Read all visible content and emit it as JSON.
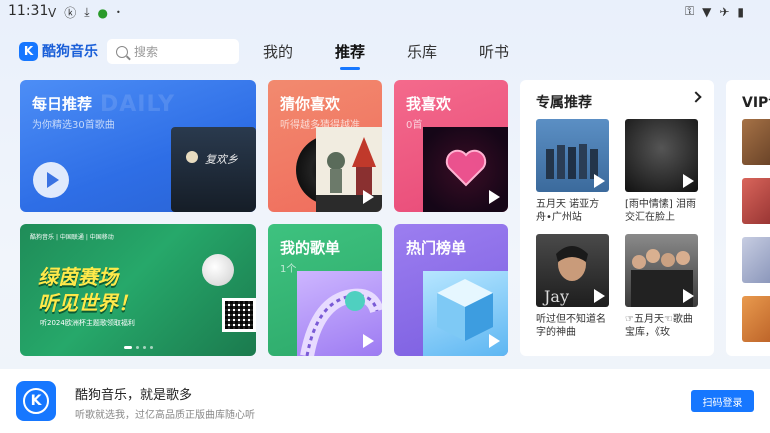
{
  "status_bar": {
    "time": "11:31",
    "left_icons": [
      "v-icon",
      "k-icon",
      "download-icon",
      "bug-icon",
      "dot-icon"
    ],
    "right_icons": [
      "key-icon",
      "wifi-icon",
      "airplane-icon",
      "battery-icon"
    ]
  },
  "header": {
    "logo_text": "酷狗音乐",
    "search_placeholder": "搜索",
    "tabs": [
      {
        "label": "我的",
        "active": false
      },
      {
        "label": "推荐",
        "active": true
      },
      {
        "label": "乐库",
        "active": false
      },
      {
        "label": "听书",
        "active": false
      }
    ]
  },
  "cards": {
    "daily": {
      "title": "每日推荐",
      "subtitle": "为你精选30首歌曲",
      "watermark": "DAILY",
      "cover_text": "复欢乡"
    },
    "banner": {
      "tag1": "酷狗音乐",
      "tag2": "中国联通",
      "tag3": "中国移动",
      "headline_line1": "绿茵赛场",
      "headline_line2": "听见世界！",
      "small_text": "听2024欧洲杯主题歌领取福利"
    },
    "guess": {
      "title": "猜你喜欢",
      "subtitle": "听得越多猜得越准"
    },
    "favorite": {
      "title": "我喜欢",
      "subtitle": "0首"
    },
    "my_playlist": {
      "title": "我的歌单",
      "subtitle": "1个"
    },
    "hot_chart": {
      "title": "热门榜单"
    }
  },
  "exclusive": {
    "title": "专属推荐",
    "items": [
      {
        "text": "五月天 诺亚方舟•广州站",
        "cover_color": "#4a7fb8"
      },
      {
        "text": "[雨中情愫] 泪雨交汇在脸上",
        "cover_color": "#2b2b2b"
      },
      {
        "text": "听过但不知道名字的神曲",
        "cover_color": "#3a3a3a"
      },
      {
        "text": "☞五月天☜歌曲宝库，《玫",
        "cover_color": "#6b6b6b"
      }
    ]
  },
  "vip": {
    "title": "VIP专",
    "thumb_colors": [
      "#8a5a3a",
      "#c0504a",
      "#9fa9c8",
      "#d4823e"
    ]
  },
  "bottom_bar": {
    "title": "酷狗音乐，就是歌多",
    "subtitle": "听歌就选我，过亿高品质正版曲库随心听",
    "login_button": "扫码登录"
  }
}
